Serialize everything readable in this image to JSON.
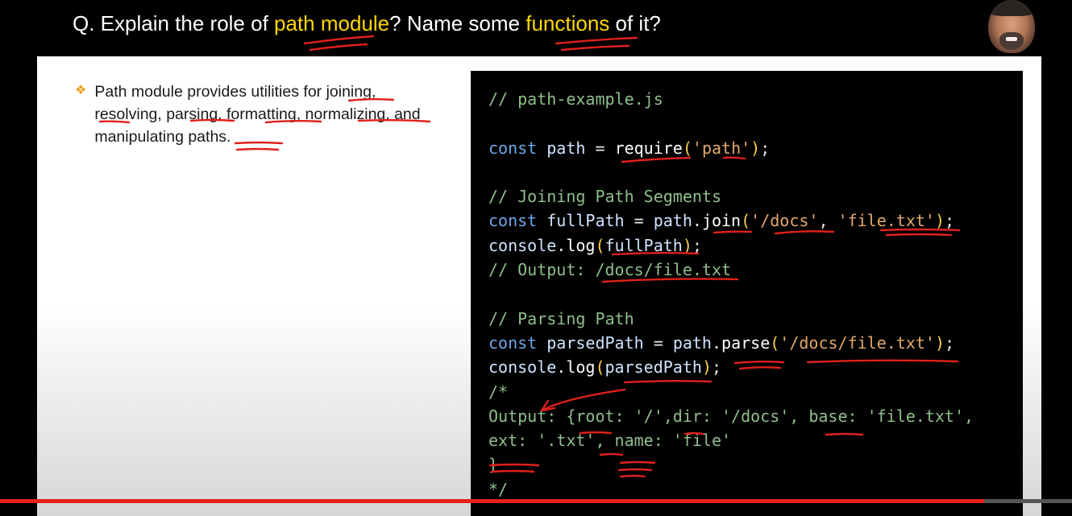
{
  "header": {
    "q_prefix": "Q. Explain the role of ",
    "q_highlight1": "path module",
    "q_middle": "? Name some ",
    "q_highlight2": "functions",
    "q_suffix": " of it?",
    "highlight_color": "#ffd700"
  },
  "slide": {
    "bullet_icon": "diamond-bullet-icon",
    "bullet_text": "Path module provides utilities for joining, resolving, parsing, formatting, normalizing, and manipulating paths."
  },
  "code": [
    [
      [
        "cm",
        "// path-example.js"
      ]
    ],
    [],
    [
      [
        "kw",
        "const"
      ],
      [
        "pu",
        " "
      ],
      [
        "vr",
        "path"
      ],
      [
        "pu",
        " = "
      ],
      [
        "fn",
        "require"
      ],
      [
        "pr",
        "("
      ],
      [
        "st",
        "'path'"
      ],
      [
        "pr",
        ")"
      ],
      [
        "pu",
        ";"
      ]
    ],
    [],
    [
      [
        "cm",
        "// Joining Path Segments"
      ]
    ],
    [
      [
        "kw",
        "const"
      ],
      [
        "pu",
        " "
      ],
      [
        "vr",
        "fullPath"
      ],
      [
        "pu",
        " = "
      ],
      [
        "vr",
        "path"
      ],
      [
        "pu",
        "."
      ],
      [
        "fn",
        "join"
      ],
      [
        "pr",
        "("
      ],
      [
        "st",
        "'/docs'"
      ],
      [
        "pu",
        ", "
      ],
      [
        "st",
        "'file.txt'"
      ],
      [
        "pr",
        ")"
      ],
      [
        "pu",
        ";"
      ]
    ],
    [
      [
        "vr",
        "console"
      ],
      [
        "pu",
        "."
      ],
      [
        "fn",
        "log"
      ],
      [
        "pr",
        "("
      ],
      [
        "vr",
        "fullPath"
      ],
      [
        "pr",
        ")"
      ],
      [
        "pu",
        ";"
      ]
    ],
    [
      [
        "cm",
        "// Output: /docs/file.txt"
      ]
    ],
    [],
    [
      [
        "cm",
        "// Parsing Path"
      ]
    ],
    [
      [
        "kw",
        "const"
      ],
      [
        "pu",
        " "
      ],
      [
        "vr",
        "parsedPath"
      ],
      [
        "pu",
        " = "
      ],
      [
        "vr",
        "path"
      ],
      [
        "pu",
        "."
      ],
      [
        "fn",
        "parse"
      ],
      [
        "pr",
        "("
      ],
      [
        "st",
        "'/docs/file.txt'"
      ],
      [
        "pr",
        ")"
      ],
      [
        "pu",
        ";"
      ]
    ],
    [
      [
        "vr",
        "console"
      ],
      [
        "pu",
        "."
      ],
      [
        "fn",
        "log"
      ],
      [
        "pr",
        "("
      ],
      [
        "vr",
        "parsedPath"
      ],
      [
        "pr",
        ")"
      ],
      [
        "pu",
        ";"
      ]
    ],
    [
      [
        "cm",
        "/*"
      ]
    ],
    [
      [
        "cm",
        "Output: {root: '/',dir: '/docs', base: 'file.txt',"
      ]
    ],
    [
      [
        "cm",
        "ext: '.txt', name: 'file'"
      ]
    ],
    [
      [
        "cm",
        "}"
      ]
    ],
    [
      [
        "cm",
        "*/"
      ]
    ]
  ],
  "player": {
    "progress": 0.918,
    "progress_color": "#e62117"
  }
}
